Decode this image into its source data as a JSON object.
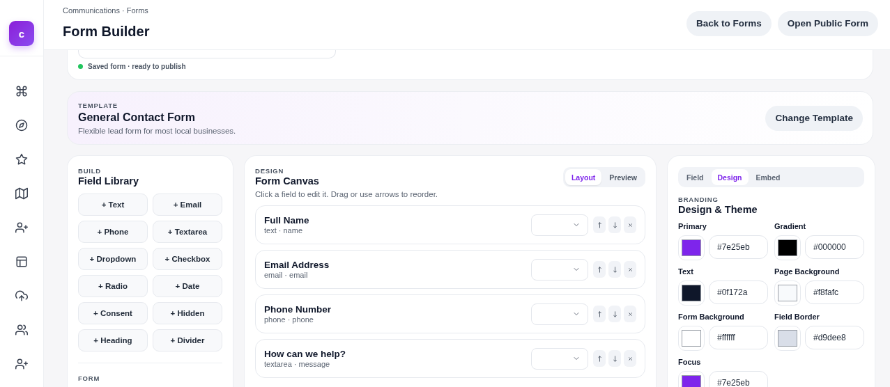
{
  "app": {
    "logo": "c"
  },
  "header": {
    "breadcrumb": "Communications · Forms",
    "title": "Form Builder",
    "buttons": [
      "Back to Forms",
      "Open Public Form"
    ]
  },
  "form_card": {
    "status": "Saved form · ready to publish"
  },
  "template": {
    "label": "TEMPLATE",
    "title": "General Contact Form",
    "description": "Flexible lead form for most local businesses.",
    "button": "Change Template"
  },
  "field_library": {
    "label": "BUILD",
    "title": "Field Library",
    "buttons": [
      "+ Text",
      "+ Email",
      "+ Phone",
      "+ Textarea",
      "+ Dropdown",
      "+ Checkbox",
      "+ Radio",
      "+ Date",
      "+ Consent",
      "+ Hidden",
      "+ Heading",
      "+ Divider"
    ],
    "setup": {
      "label": "FORM"
    }
  },
  "canvas": {
    "label": "DESIGN",
    "title": "Form Canvas",
    "hint": "Click a field to edit it. Drag or use arrows to reorder.",
    "view_tabs": [
      {
        "label": "Layout",
        "selected": true
      },
      {
        "label": "Preview",
        "selected": false
      }
    ],
    "fields": [
      {
        "name": "Full Name",
        "meta": "text · name"
      },
      {
        "name": "Email Address",
        "meta": "email · email"
      },
      {
        "name": "Phone Number",
        "meta": "phone · phone"
      },
      {
        "name": "How can we help?",
        "meta": "textarea · message"
      }
    ]
  },
  "inspector": {
    "tabs": [
      {
        "label": "Field",
        "selected": false
      },
      {
        "label": "Design",
        "selected": true
      },
      {
        "label": "Embed",
        "selected": false
      }
    ],
    "label": "BRANDING",
    "title": "Design & Theme",
    "colors": [
      {
        "label": "Primary",
        "value": "#7e25eb",
        "color": "#7e25eb"
      },
      {
        "label": "Gradient",
        "value": "#000000",
        "color": "#000000"
      },
      {
        "label": "Text",
        "value": "#0f172a",
        "color": "#0f172a"
      },
      {
        "label": "Page Background",
        "value": "#f8fafc",
        "color": "#f8fafc"
      },
      {
        "label": "Form Background",
        "value": "#ffffff",
        "color": "#ffffff"
      },
      {
        "label": "Field Border",
        "value": "#d9dee8",
        "color": "#d9dee8"
      },
      {
        "label": "Focus",
        "value": "#7e25eb",
        "color": "#7e25eb"
      }
    ]
  }
}
